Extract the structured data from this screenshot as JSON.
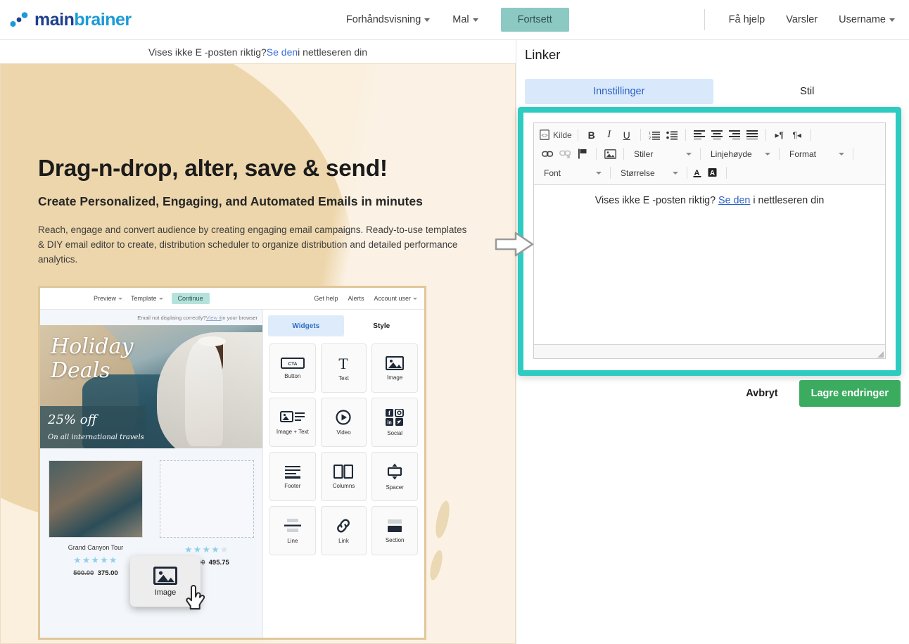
{
  "topbar": {
    "logo_main": "main",
    "logo_brainer": "brainer",
    "nav": [
      {
        "label": "Forhåndsvisning",
        "caret": true
      },
      {
        "label": "Mal",
        "caret": true
      }
    ],
    "continue_label": "Fortsett",
    "right": [
      {
        "label": "Få hjelp",
        "caret": false
      },
      {
        "label": "Varsler",
        "caret": false
      },
      {
        "label": "Username",
        "caret": true
      }
    ]
  },
  "preview": {
    "notice_prefix": "Vises ikke E -posten riktig? ",
    "notice_link": "Se den",
    "notice_suffix": " i nettleseren din",
    "heading": "Drag-n-drop, alter, save & send!",
    "subheading": "Create Personalized, Engaging, and Automated Emails in minutes",
    "paragraph": "Reach, engage and convert audience by creating engaging email campaigns. Ready-to-use templates & DIY email editor to create, distribution scheduler to organize distribution and detailed performance analytics."
  },
  "inner_screenshot": {
    "toolbar_left": [
      {
        "label": "Preview",
        "caret": true
      },
      {
        "label": "Template",
        "caret": true
      }
    ],
    "continue_label": "Continue",
    "toolbar_right": [
      {
        "label": "Get help",
        "caret": false
      },
      {
        "label": "Alerts",
        "caret": false
      },
      {
        "label": "Account user",
        "caret": true
      }
    ],
    "notice_prefix": "Email not displaing correctly? ",
    "notice_link": "View it",
    "notice_suffix": " in your browser",
    "banner": {
      "title_line1": "Holiday",
      "title_line2": "Deals",
      "offer": "25% off",
      "offer_sub": "On all international travels"
    },
    "products": [
      {
        "name": "Grand Canyon Tour",
        "stars_filled": 5,
        "stars_total": 5,
        "old_price": "500.00",
        "new_price": "375.00"
      },
      {
        "name": "",
        "stars_filled": 4,
        "stars_total": 5,
        "old_price": "661.00",
        "new_price": "495.75"
      }
    ],
    "tabs": [
      {
        "label": "Widgets",
        "active": true
      },
      {
        "label": "Style",
        "active": false
      }
    ],
    "widgets": [
      {
        "label": "Button",
        "icon": "cta-button-icon"
      },
      {
        "label": "Text",
        "icon": "text-t-icon"
      },
      {
        "label": "Image",
        "icon": "image-icon"
      },
      {
        "label": "Image + Text",
        "icon": "image-text-icon"
      },
      {
        "label": "Video",
        "icon": "video-play-icon"
      },
      {
        "label": "Social",
        "icon": "social-icons-icon"
      },
      {
        "label": "Footer",
        "icon": "footer-icon"
      },
      {
        "label": "Columns",
        "icon": "columns-icon"
      },
      {
        "label": "Spacer",
        "icon": "spacer-icon"
      },
      {
        "label": "Line",
        "icon": "line-icon"
      },
      {
        "label": "Link",
        "icon": "link-chain-icon"
      },
      {
        "label": "Section",
        "icon": "section-icon"
      }
    ],
    "dragging_widget": {
      "label": "Image",
      "icon": "image-icon"
    }
  },
  "right_panel": {
    "title": "Linker",
    "tabs": [
      {
        "label": "Innstillinger",
        "active": true
      },
      {
        "label": "Stil",
        "active": false
      }
    ],
    "editor": {
      "toolbar_row1": {
        "source_label": "Kilde",
        "buttons": [
          "bold",
          "italic",
          "underline",
          "numbered-list",
          "bulleted-list",
          "align-left",
          "align-center",
          "align-right",
          "align-justify",
          "ltr-paragraph",
          "rtl-paragraph"
        ]
      },
      "toolbar_row2": {
        "buttons": [
          "link",
          "unlink",
          "anchor-flag",
          "image"
        ],
        "selects": [
          "Stiler",
          "Linjehøyde",
          "Format"
        ]
      },
      "toolbar_row3": {
        "selects": [
          "Font",
          "Størrelse"
        ],
        "buttons": [
          "text-color",
          "background-color"
        ]
      },
      "content_prefix": "Vises ikke E -posten riktig? ",
      "content_link": "Se den",
      "content_suffix": " i nettleseren din"
    },
    "cancel_label": "Avbryt",
    "save_label": "Lagre endringer"
  },
  "colors": {
    "accent_teal": "#2ecbc0",
    "header_button": "#8cc9c3",
    "save_green": "#3bab5f",
    "tab_active_bg": "#d9e8fb",
    "tab_active_text": "#2a62c4",
    "link_blue": "#2a62c4",
    "canvas_bg": "#fbf0de",
    "circle_tan": "#edd6ab"
  }
}
